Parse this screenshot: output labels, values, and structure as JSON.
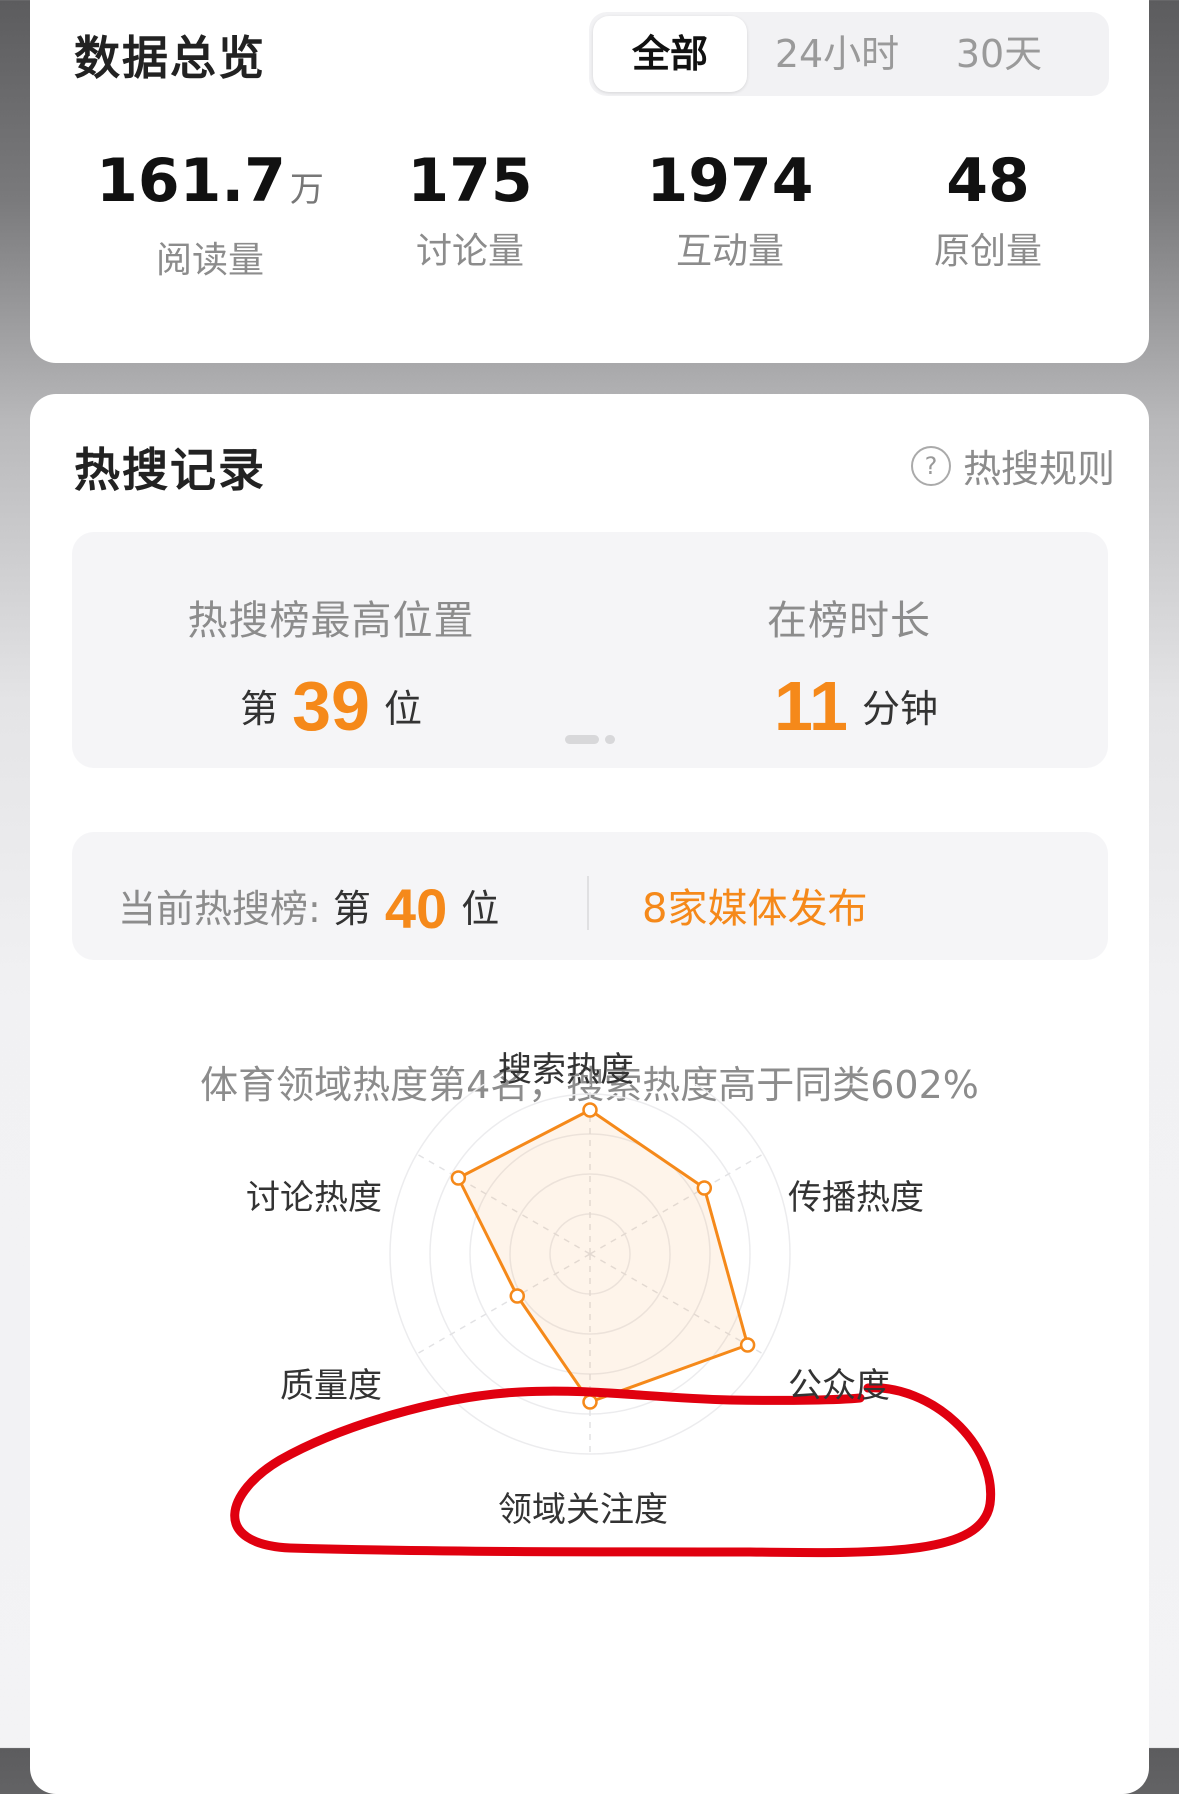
{
  "overview": {
    "title": "数据总览",
    "tabs": [
      "全部",
      "24小时",
      "30天"
    ],
    "stats": [
      {
        "value": "161.7",
        "unit": "万",
        "label": "阅读量"
      },
      {
        "value": "175",
        "unit": "",
        "label": "讨论量"
      },
      {
        "value": "1974",
        "unit": "",
        "label": "互动量"
      },
      {
        "value": "48",
        "unit": "",
        "label": "原创量"
      }
    ]
  },
  "hot": {
    "title": "热搜记录",
    "rule_label": "热搜规则",
    "help_glyph": "?",
    "peak": {
      "label": "热搜榜最高位置",
      "prefix": "第",
      "value": "39",
      "suffix": "位"
    },
    "duration": {
      "label": "在榜时长",
      "value": "11",
      "unit": "分钟"
    },
    "current": {
      "label": "当前热搜榜:",
      "prefix": "第",
      "value": "40",
      "suffix": "位"
    },
    "media": "8家媒体发布",
    "summary": "体育领域热度第4名，搜索热度高于同类602%",
    "radar": {
      "axes": [
        "搜索热度",
        "传播热度",
        "公众度",
        "领域关注度",
        "质量度",
        "讨论热度"
      ],
      "values": [
        0.72,
        0.66,
        0.91,
        0.74,
        0.42,
        0.76
      ],
      "accent": "#f5891a",
      "highlight": "#e0000f"
    }
  }
}
